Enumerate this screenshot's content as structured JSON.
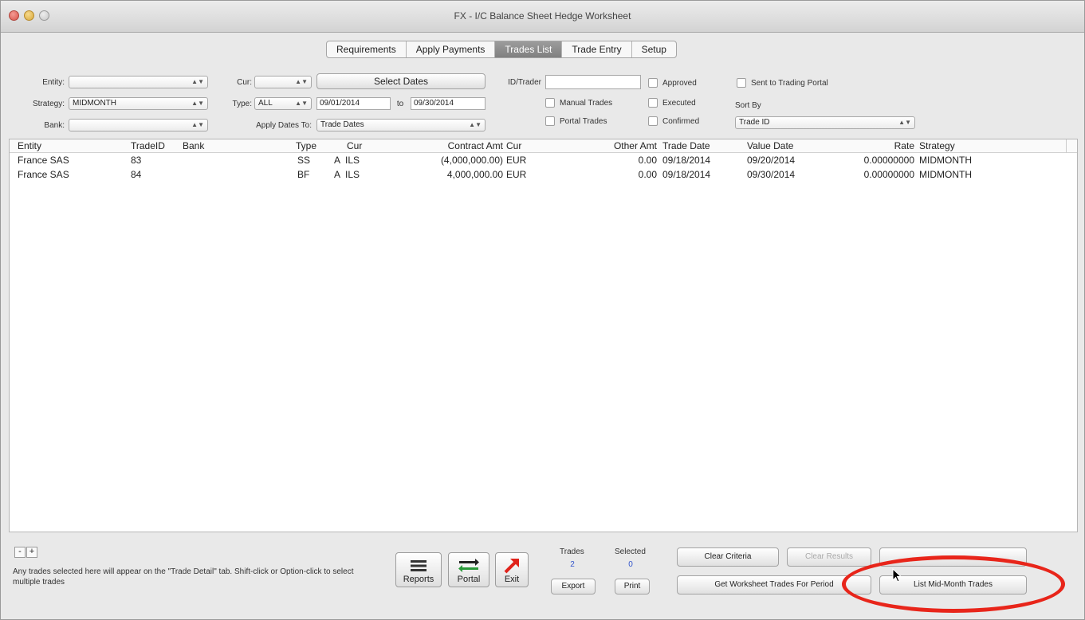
{
  "window": {
    "title": "FX - I/C Balance Sheet Hedge Worksheet"
  },
  "tabs": [
    {
      "label": "Requirements",
      "active": false
    },
    {
      "label": "Apply Payments",
      "active": false
    },
    {
      "label": "Trades List",
      "active": true
    },
    {
      "label": "Trade Entry",
      "active": false
    },
    {
      "label": "Setup",
      "active": false
    }
  ],
  "filters": {
    "entity_label": "Entity:",
    "entity_value": "",
    "strategy_label": "Strategy:",
    "strategy_value": "MIDMONTH",
    "bank_label": "Bank:",
    "bank_value": "",
    "cur_label": "Cur:",
    "cur_value": "",
    "type_label": "Type:",
    "type_value": "ALL",
    "apply_dates_label": "Apply Dates To:",
    "apply_dates_value": "Trade Dates",
    "select_dates_label": "Select Dates",
    "date_from": "09/01/2014",
    "date_to_label": "to",
    "date_to": "09/30/2014",
    "id_trader_label": "ID/Trader",
    "id_trader_value": "",
    "manual_trades": "Manual Trades",
    "portal_trades": "Portal Trades",
    "approved": "Approved",
    "executed": "Executed",
    "confirmed": "Confirmed",
    "sent_portal": "Sent to Trading Portal",
    "sort_by_label": "Sort By",
    "sort_by_value": "Trade ID"
  },
  "table": {
    "headers": [
      "Entity",
      "TradeID",
      "Bank",
      "Type",
      "Cur",
      "Contract Amt",
      "Cur",
      "Other Amt",
      "Trade Date",
      "Value Date",
      "Rate",
      "Strategy"
    ],
    "rows": [
      [
        "France SAS",
        "83",
        "",
        "SS",
        "A",
        "ILS",
        "(4,000,000.00)",
        "EUR",
        "0.00",
        "09/18/2014",
        "09/20/2014",
        "0.00000000",
        "MIDMONTH"
      ],
      [
        "France SAS",
        "84",
        "",
        "BF",
        "A",
        "ILS",
        "4,000,000.00",
        "EUR",
        "0.00",
        "09/18/2014",
        "09/30/2014",
        "0.00000000",
        "MIDMONTH"
      ]
    ]
  },
  "bottom": {
    "minus": "-",
    "plus": "+",
    "help_text": "Any trades selected here will appear on the \"Trade Detail\" tab.  Shift-click or Option-click to select multiple trades",
    "reports": "Reports",
    "portal": "Portal",
    "exit": "Exit",
    "trades_label": "Trades",
    "trades_count": "2",
    "selected_label": "Selected",
    "selected_count": "0",
    "export": "Export",
    "print": "Print",
    "clear_criteria": "Clear Criteria",
    "clear_results": "Clear Results",
    "get_worksheet": "Get Worksheet Trades For Period",
    "list_midmonth": "List Mid-Month Trades"
  },
  "colors": {
    "highlight": "#e8251a",
    "active_tab": "#8c8c8c",
    "count": "#3355cc"
  }
}
